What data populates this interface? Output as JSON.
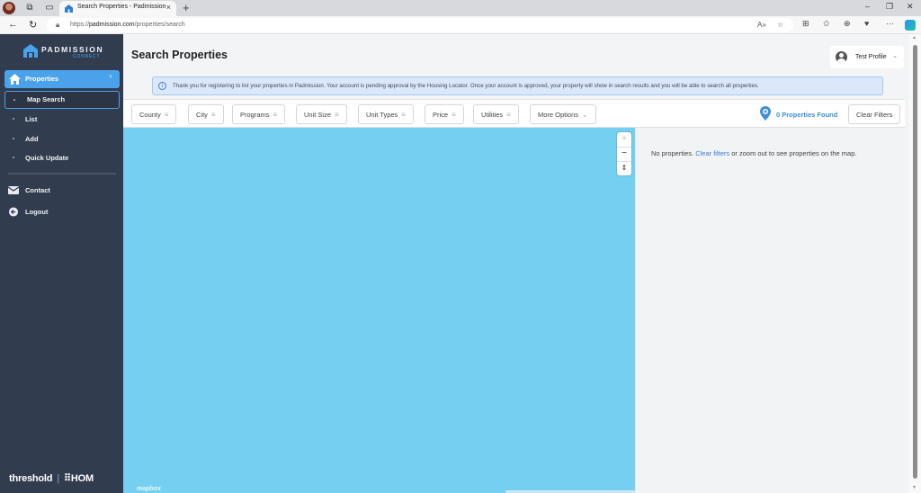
{
  "browser": {
    "tab_title": "Search Properties - Padmission",
    "url_domain": "padmission.com",
    "url_path": "/properties/search",
    "url_scheme": "https://"
  },
  "sidebar": {
    "brand": "PADMISSION",
    "brand_sub": "CONNECT",
    "properties_label": "Properties",
    "sub_items": [
      {
        "label": "Map Search",
        "active": true
      },
      {
        "label": "List",
        "active": false
      },
      {
        "label": "Add",
        "active": false
      },
      {
        "label": "Quick Update",
        "active": false
      }
    ],
    "links": [
      {
        "label": "Contact",
        "icon": "envelope-icon"
      },
      {
        "label": "Logout",
        "icon": "logout-icon"
      }
    ],
    "footer": {
      "left": "threshold",
      "sep": "|",
      "right": "⠿HOM"
    }
  },
  "header": {
    "title": "Search Properties",
    "profile_label": "Test Profile"
  },
  "notice": {
    "text": "Thank you for registering to list your properties in Padmission. Your account is pending approval by the Housing Locator. Once your account is approved, your property will show in search results and you will be able to search all properties."
  },
  "filters": [
    {
      "label": "County",
      "icon": "filter-icon"
    },
    {
      "label": "City",
      "icon": "filter-icon"
    },
    {
      "label": "Programs",
      "icon": "filter-icon"
    },
    {
      "label": "Unit Size",
      "icon": "filter-icon"
    },
    {
      "label": "Unit Types",
      "icon": "filter-icon"
    },
    {
      "label": "Price",
      "icon": "filter-icon"
    },
    {
      "label": "Utilities",
      "icon": "filter-icon"
    },
    {
      "label": "More Options",
      "icon": "chevron-down-icon"
    }
  ],
  "results_summary": {
    "found_label": "0 Properties Found",
    "clear_filters_label": "Clear Filters"
  },
  "map": {
    "zoom_in": "+",
    "zoom_out": "−",
    "compass": "⇕",
    "attribution": "mapbox",
    "water_color": "#75cff0"
  },
  "results": {
    "msg_before": "No properties. ",
    "msg_link": "Clear filters",
    "msg_after": " or zoom out to see properties on the map."
  },
  "colors": {
    "accent": "#4aa3ea",
    "sidebar_bg": "#323c4f",
    "link": "#3d7cd8"
  }
}
